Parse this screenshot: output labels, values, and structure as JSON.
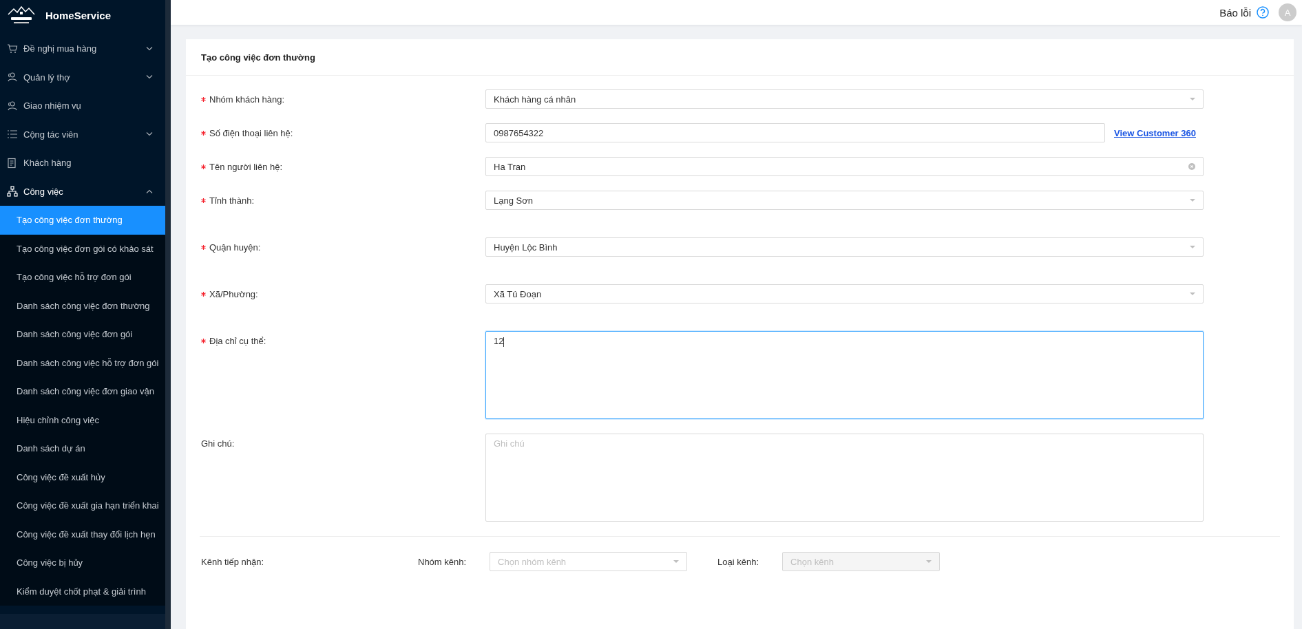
{
  "app": {
    "name": "HomeService"
  },
  "header": {
    "report_label": "Báo lỗi",
    "avatar_letter": "A"
  },
  "sidebar": {
    "items": [
      {
        "label": "Đề nghị mua hàng",
        "expandable": true,
        "expanded": false
      },
      {
        "label": "Quản lý thợ",
        "expandable": true,
        "expanded": false
      },
      {
        "label": "Giao nhiệm vụ",
        "expandable": false
      },
      {
        "label": "Cộng tác viên",
        "expandable": true,
        "expanded": false
      },
      {
        "label": "Khách hàng",
        "expandable": false
      },
      {
        "label": "Công việc",
        "expandable": true,
        "expanded": true,
        "children": [
          {
            "label": "Tạo công việc đơn thường",
            "selected": true
          },
          {
            "label": "Tạo công việc đơn gói có khảo sát",
            "selected": false
          },
          {
            "label": "Tạo công việc hỗ trợ đơn gói",
            "selected": false
          },
          {
            "label": "Danh sách công việc đơn thường",
            "selected": false
          },
          {
            "label": "Danh sách công việc đơn gói",
            "selected": false
          },
          {
            "label": "Danh sách công việc hỗ trợ đơn gói",
            "selected": false
          },
          {
            "label": "Danh sách công việc đơn giao vận",
            "selected": false
          },
          {
            "label": "Hiệu chỉnh công việc",
            "selected": false
          },
          {
            "label": "Danh sách dự án",
            "selected": false
          },
          {
            "label": "Công việc đề xuất hủy",
            "selected": false
          },
          {
            "label": "Công việc đề xuất gia hạn triển khai",
            "selected": false
          },
          {
            "label": "Công việc đề xuất thay đổi lịch hẹn",
            "selected": false
          },
          {
            "label": "Công việc bị hủy",
            "selected": false
          },
          {
            "label": "Kiểm duyệt chốt phạt & giải trình",
            "selected": false
          }
        ]
      }
    ]
  },
  "form": {
    "title": "Tạo công việc đơn thường",
    "fields": [
      {
        "kind": "select",
        "label": "Nhóm khách hàng:",
        "required": true,
        "value": "Khách hàng cá nhân"
      },
      {
        "kind": "input",
        "label": "Số điện thoại liên hệ:",
        "required": true,
        "value": "0987654322",
        "link": "View Customer 360"
      },
      {
        "kind": "clearable",
        "label": "Tên người liên hệ:",
        "required": true,
        "value": "Ha Tran"
      },
      {
        "kind": "select",
        "label": "Tỉnh thành:",
        "required": true,
        "value": "Lạng Sơn"
      },
      {
        "kind": "select",
        "label": "Quận huyện:",
        "required": true,
        "value": "Huyện Lộc Bình"
      },
      {
        "kind": "select",
        "label": "Xã/Phường:",
        "required": true,
        "value": "Xã Tú Đoạn"
      },
      {
        "kind": "textarea",
        "label": "Địa chỉ cụ thể:",
        "required": true,
        "value": "12",
        "focused": true
      },
      {
        "kind": "textarea",
        "label": "Ghi chú:",
        "required": false,
        "placeholder": "Ghi chú",
        "focused": false
      }
    ],
    "channel": {
      "label": "Kênh tiếp nhận:",
      "selects": [
        {
          "label": "Nhóm kênh:",
          "placeholder": "Chọn nhóm kênh",
          "disabled": false
        },
        {
          "label": "Loại kênh:",
          "placeholder": "Chọn kênh",
          "disabled": true
        }
      ]
    }
  }
}
